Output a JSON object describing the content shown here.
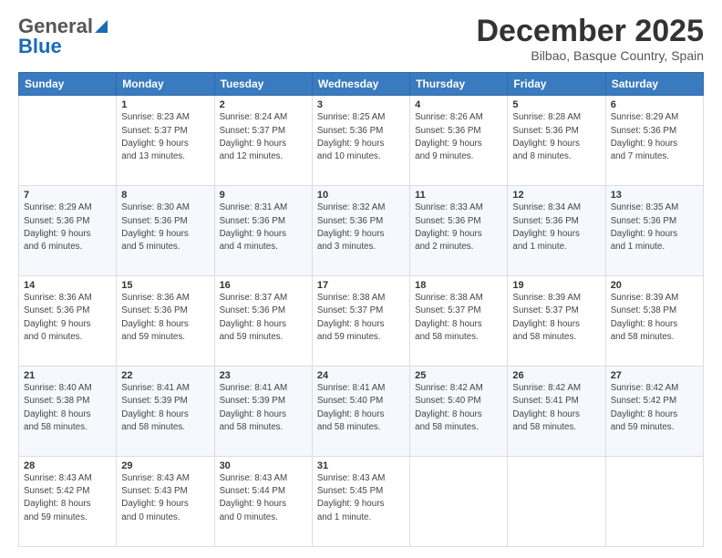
{
  "header": {
    "logo_general": "General",
    "logo_blue": "Blue",
    "month_title": "December 2025",
    "location": "Bilbao, Basque Country, Spain"
  },
  "weekdays": [
    "Sunday",
    "Monday",
    "Tuesday",
    "Wednesday",
    "Thursday",
    "Friday",
    "Saturday"
  ],
  "weeks": [
    [
      {
        "day": "",
        "info": ""
      },
      {
        "day": "1",
        "info": "Sunrise: 8:23 AM\nSunset: 5:37 PM\nDaylight: 9 hours\nand 13 minutes."
      },
      {
        "day": "2",
        "info": "Sunrise: 8:24 AM\nSunset: 5:37 PM\nDaylight: 9 hours\nand 12 minutes."
      },
      {
        "day": "3",
        "info": "Sunrise: 8:25 AM\nSunset: 5:36 PM\nDaylight: 9 hours\nand 10 minutes."
      },
      {
        "day": "4",
        "info": "Sunrise: 8:26 AM\nSunset: 5:36 PM\nDaylight: 9 hours\nand 9 minutes."
      },
      {
        "day": "5",
        "info": "Sunrise: 8:28 AM\nSunset: 5:36 PM\nDaylight: 9 hours\nand 8 minutes."
      },
      {
        "day": "6",
        "info": "Sunrise: 8:29 AM\nSunset: 5:36 PM\nDaylight: 9 hours\nand 7 minutes."
      }
    ],
    [
      {
        "day": "7",
        "info": "Sunrise: 8:29 AM\nSunset: 5:36 PM\nDaylight: 9 hours\nand 6 minutes."
      },
      {
        "day": "8",
        "info": "Sunrise: 8:30 AM\nSunset: 5:36 PM\nDaylight: 9 hours\nand 5 minutes."
      },
      {
        "day": "9",
        "info": "Sunrise: 8:31 AM\nSunset: 5:36 PM\nDaylight: 9 hours\nand 4 minutes."
      },
      {
        "day": "10",
        "info": "Sunrise: 8:32 AM\nSunset: 5:36 PM\nDaylight: 9 hours\nand 3 minutes."
      },
      {
        "day": "11",
        "info": "Sunrise: 8:33 AM\nSunset: 5:36 PM\nDaylight: 9 hours\nand 2 minutes."
      },
      {
        "day": "12",
        "info": "Sunrise: 8:34 AM\nSunset: 5:36 PM\nDaylight: 9 hours\nand 1 minute."
      },
      {
        "day": "13",
        "info": "Sunrise: 8:35 AM\nSunset: 5:36 PM\nDaylight: 9 hours\nand 1 minute."
      }
    ],
    [
      {
        "day": "14",
        "info": "Sunrise: 8:36 AM\nSunset: 5:36 PM\nDaylight: 9 hours\nand 0 minutes."
      },
      {
        "day": "15",
        "info": "Sunrise: 8:36 AM\nSunset: 5:36 PM\nDaylight: 8 hours\nand 59 minutes."
      },
      {
        "day": "16",
        "info": "Sunrise: 8:37 AM\nSunset: 5:36 PM\nDaylight: 8 hours\nand 59 minutes."
      },
      {
        "day": "17",
        "info": "Sunrise: 8:38 AM\nSunset: 5:37 PM\nDaylight: 8 hours\nand 59 minutes."
      },
      {
        "day": "18",
        "info": "Sunrise: 8:38 AM\nSunset: 5:37 PM\nDaylight: 8 hours\nand 58 minutes."
      },
      {
        "day": "19",
        "info": "Sunrise: 8:39 AM\nSunset: 5:37 PM\nDaylight: 8 hours\nand 58 minutes."
      },
      {
        "day": "20",
        "info": "Sunrise: 8:39 AM\nSunset: 5:38 PM\nDaylight: 8 hours\nand 58 minutes."
      }
    ],
    [
      {
        "day": "21",
        "info": "Sunrise: 8:40 AM\nSunset: 5:38 PM\nDaylight: 8 hours\nand 58 minutes."
      },
      {
        "day": "22",
        "info": "Sunrise: 8:41 AM\nSunset: 5:39 PM\nDaylight: 8 hours\nand 58 minutes."
      },
      {
        "day": "23",
        "info": "Sunrise: 8:41 AM\nSunset: 5:39 PM\nDaylight: 8 hours\nand 58 minutes."
      },
      {
        "day": "24",
        "info": "Sunrise: 8:41 AM\nSunset: 5:40 PM\nDaylight: 8 hours\nand 58 minutes."
      },
      {
        "day": "25",
        "info": "Sunrise: 8:42 AM\nSunset: 5:40 PM\nDaylight: 8 hours\nand 58 minutes."
      },
      {
        "day": "26",
        "info": "Sunrise: 8:42 AM\nSunset: 5:41 PM\nDaylight: 8 hours\nand 58 minutes."
      },
      {
        "day": "27",
        "info": "Sunrise: 8:42 AM\nSunset: 5:42 PM\nDaylight: 8 hours\nand 59 minutes."
      }
    ],
    [
      {
        "day": "28",
        "info": "Sunrise: 8:43 AM\nSunset: 5:42 PM\nDaylight: 8 hours\nand 59 minutes."
      },
      {
        "day": "29",
        "info": "Sunrise: 8:43 AM\nSunset: 5:43 PM\nDaylight: 9 hours\nand 0 minutes."
      },
      {
        "day": "30",
        "info": "Sunrise: 8:43 AM\nSunset: 5:44 PM\nDaylight: 9 hours\nand 0 minutes."
      },
      {
        "day": "31",
        "info": "Sunrise: 8:43 AM\nSunset: 5:45 PM\nDaylight: 9 hours\nand 1 minute."
      },
      {
        "day": "",
        "info": ""
      },
      {
        "day": "",
        "info": ""
      },
      {
        "day": "",
        "info": ""
      }
    ]
  ]
}
